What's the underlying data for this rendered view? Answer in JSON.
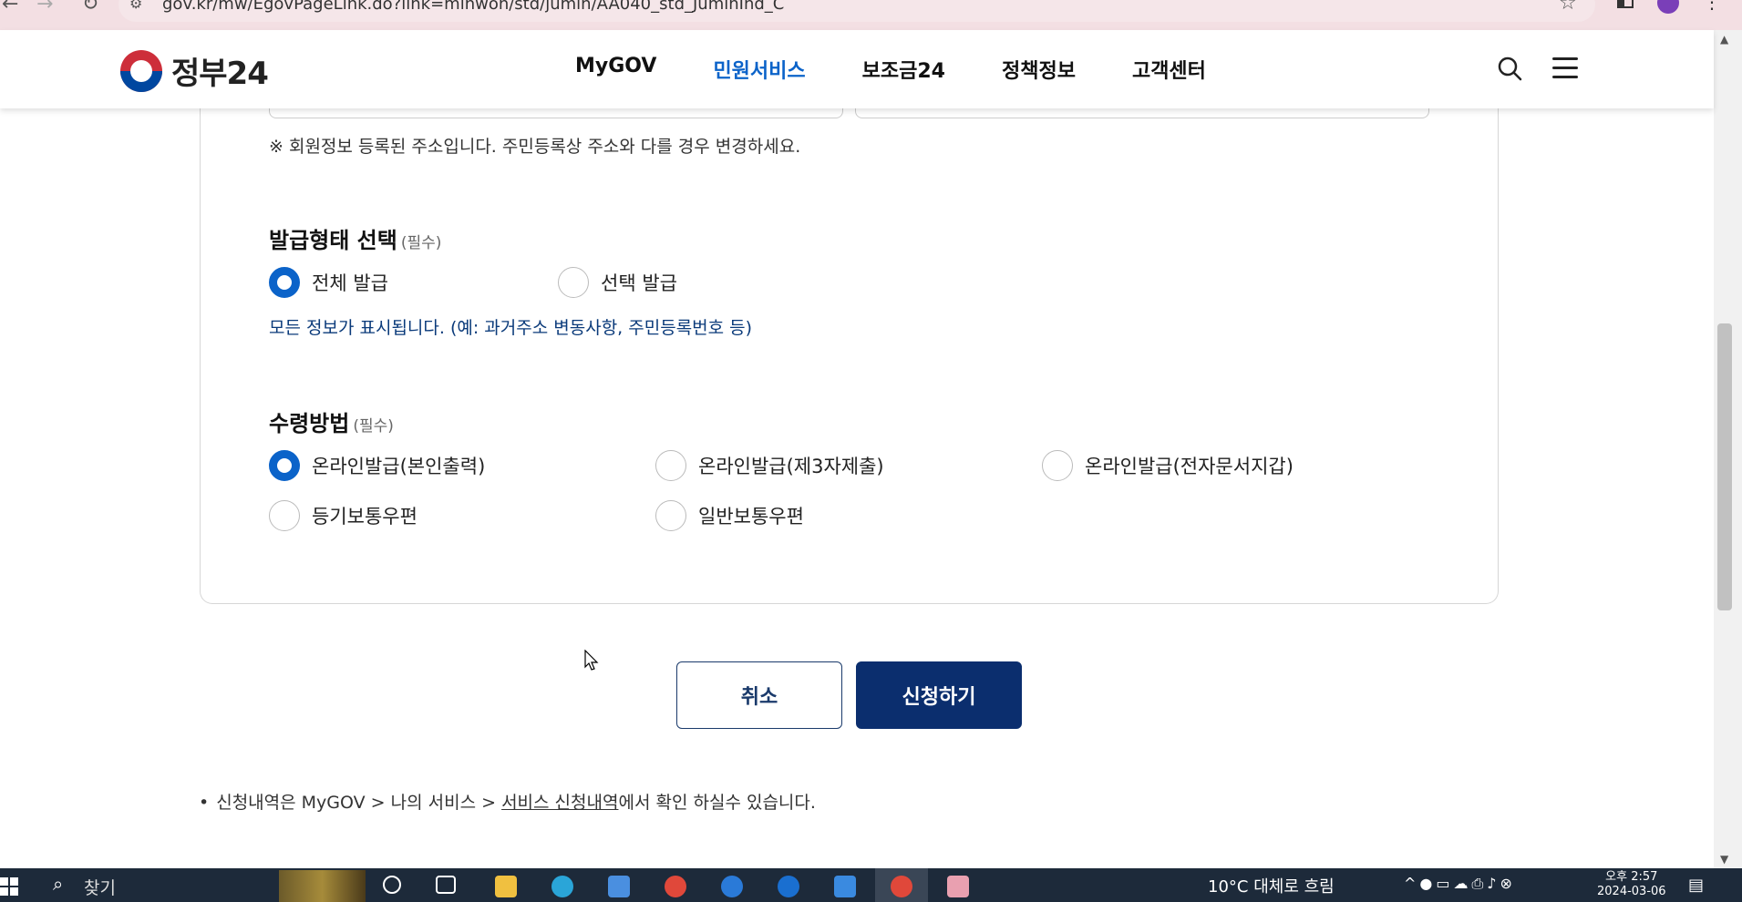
{
  "browser": {
    "url": "gov.kr/mw/EgovPageLink.do?link=minwon/std/jumin/AA040_std_JuminInd_C"
  },
  "header": {
    "logo_text": "정부24",
    "nav": [
      "MyGOV",
      "민원서비스",
      "보조금24",
      "정책정보",
      "고객센터"
    ],
    "active_nav": "민원서비스"
  },
  "address": {
    "notice": "※ 회원정보 등록된 주소입니다. 주민등록상 주소와 다를 경우 변경하세요."
  },
  "issue_type": {
    "title": "발급형태 선택",
    "required": "(필수)",
    "options": [
      "전체 발급",
      "선택 발급"
    ],
    "selected": "전체 발급",
    "help": "모든 정보가 표시됩니다. (예: 과거주소 변동사항, 주민등록번호 등)"
  },
  "receive_method": {
    "title": "수령방법",
    "required": "(필수)",
    "options": [
      "온라인발급(본인출력)",
      "온라인발급(제3자제출)",
      "온라인발급(전자문서지갑)",
      "등기보통우편",
      "일반보통우편"
    ],
    "selected": "온라인발급(본인출력)"
  },
  "actions": {
    "cancel": "취소",
    "submit": "신청하기"
  },
  "footnote": {
    "bullet": "•",
    "prefix": "신청내역은 MyGOV > 나의 서비스 > ",
    "link": "서비스 신청내역",
    "suffix": "에서 확인 하실수 있습니다."
  },
  "taskbar": {
    "search_placeholder": "찾기",
    "weather": "10°C  대체로 흐림",
    "time": "오후 2:57",
    "date": "2024-03-06"
  }
}
